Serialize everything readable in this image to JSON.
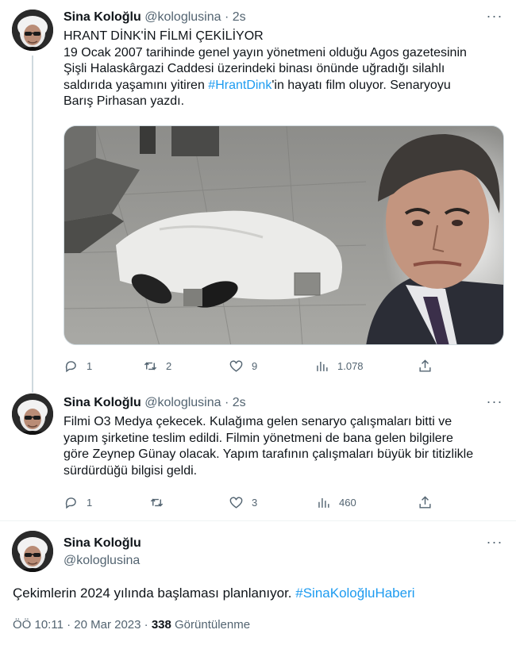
{
  "tweets": [
    {
      "name": "Sina Koloğlu",
      "handle": "@kologlusina",
      "time": "· 2s",
      "more": "···",
      "headline": "HRANT DİNK'İN FİLMİ ÇEKİLİYOR",
      "body_line1": "19 Ocak 2007 tarihinde  genel yayın yönetmeni olduğu Agos gazetesinin",
      "body_line2": "Şişli Halaskârgazi Caddesi üzerindeki binası önünde uğradığı silahlı",
      "body_line3_pre": "saldırıda yaşamını yitiren ",
      "hashtag": "#HrantDink",
      "body_line3_post": "'in hayatı film oluyor. Senaryoyu",
      "body_line4": "Barış Pirhasan yazdı.",
      "replies": "1",
      "retweets": "2",
      "likes": "9",
      "views": "1.078"
    },
    {
      "name": "Sina Koloğlu",
      "handle": "@kologlusina",
      "time": "· 2s",
      "more": "···",
      "line1": "Filmi O3 Medya çekecek. Kulağıma gelen senaryo çalışmaları bitti ve",
      "line2": "yapım şirketine teslim edildi. Filmin yönetmeni de bana gelen bilgilere",
      "line3": "göre Zeynep Günay olacak. Yapım tarafının çalışmaları büyük bir titizlikle",
      "line4": "sürdürdüğü  bilgisi geldi.",
      "replies": "1",
      "retweets": "",
      "likes": "3",
      "views": "460"
    },
    {
      "name": "Sina Koloğlu",
      "handle": "@kologlusina",
      "more": "···",
      "text_pre": "Çekimlerin 2024 yılında  başlaması planlanıyor. ",
      "hashtag": "#SinaKoloğluHaberi",
      "time": "ÖÖ 10:11 · 20 Mar 2023 · ",
      "views_count": "338",
      "views_label": " Görüntülenme"
    }
  ],
  "icons": {
    "reply": "reply-icon",
    "retweet": "retweet-icon",
    "like": "like-icon",
    "views": "views-icon",
    "share": "share-icon"
  },
  "colors": {
    "link": "#1d9bf0",
    "secondary": "#536471",
    "text": "#0f1419",
    "divider": "#cfd9de"
  }
}
